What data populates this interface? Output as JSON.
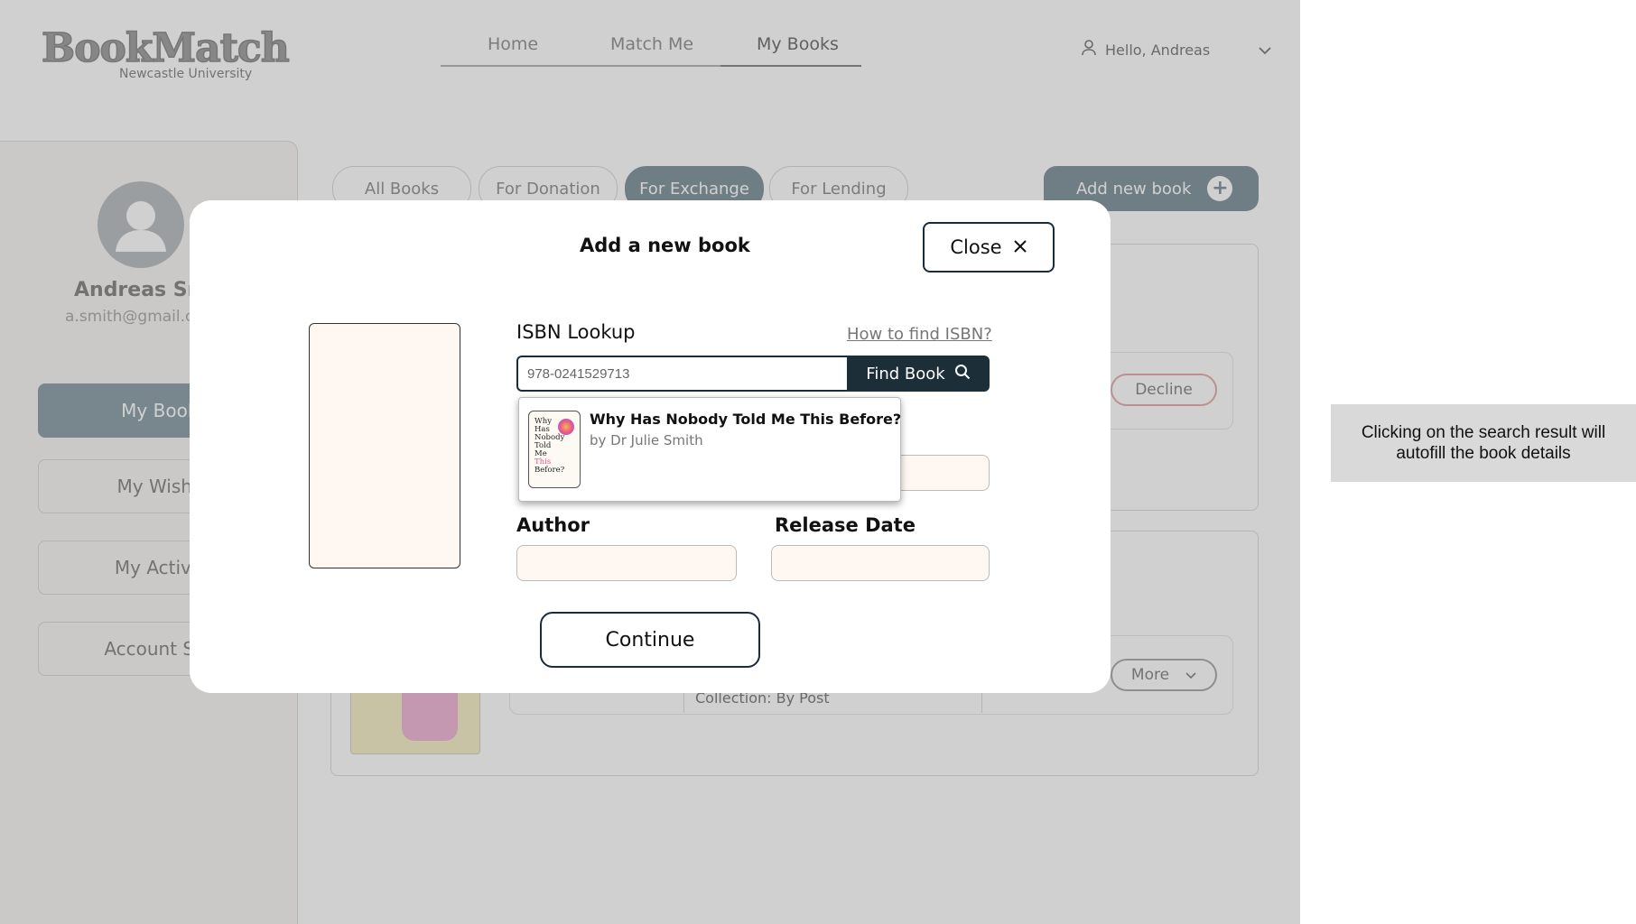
{
  "header": {
    "logo_text": "BookMatch",
    "logo_subtitle": "Newcastle University",
    "nav": [
      "Home",
      "Match Me",
      "My Books"
    ],
    "active_nav": "My Books",
    "user_greeting": "Hello, Andreas"
  },
  "sidebar": {
    "name": "Andreas Sm",
    "email": "a.smith@gmail.c",
    "items": [
      {
        "label": "My Books",
        "active": true
      },
      {
        "label": "My Wishlis",
        "active": false
      },
      {
        "label": "My Activity",
        "active": false
      },
      {
        "label": "Account Setti",
        "active": false
      }
    ]
  },
  "main": {
    "tabs": [
      {
        "label": "All Books",
        "active": false
      },
      {
        "label": "For Donation",
        "active": false
      },
      {
        "label": "For Exchange",
        "active": true
      },
      {
        "label": "For Lending",
        "active": false
      }
    ],
    "add_new_book": "Add new book",
    "decline": "Decline",
    "more": "More",
    "collection": "Collection: By Post"
  },
  "modal": {
    "title": "Add a new book",
    "close": "Close",
    "isbn_label": "ISBN Lookup",
    "how_to_find": "How to find ISBN?",
    "isbn_value": "978-0241529713",
    "find_book": "Find Book",
    "author_label": "Author",
    "release_label": "Release Date",
    "continue": "Continue",
    "search_result": {
      "title": "Why Has Nobody Told Me This Before?",
      "author": "by Dr Julie Smith",
      "cover_lines": [
        "Why",
        "Has",
        "Nobody",
        "Told",
        "Me",
        "This",
        "Before?"
      ]
    }
  },
  "annotation": {
    "text": "Clicking on the search result will autofill the book details"
  },
  "colors": {
    "primary_dark": "#1c2e38",
    "accent_slate": "#4f6a77",
    "field_bg": "#fff8f2",
    "decline_border": "#d98b8b"
  }
}
